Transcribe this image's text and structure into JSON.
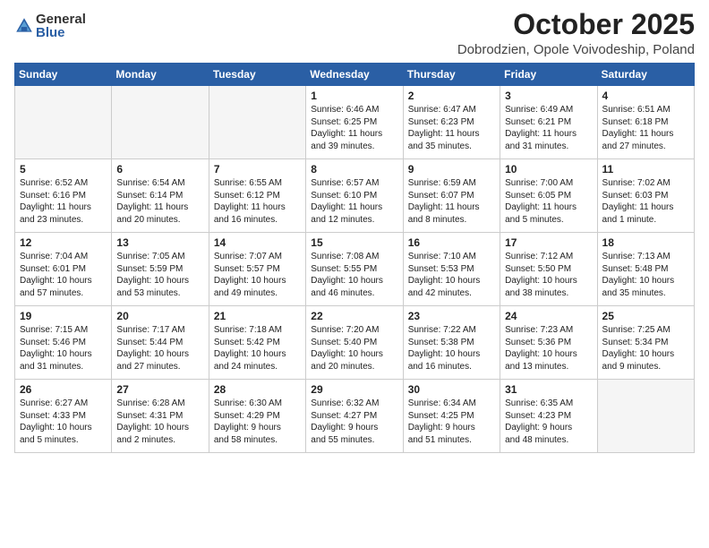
{
  "logo": {
    "general": "General",
    "blue": "Blue"
  },
  "header": {
    "month": "October 2025",
    "location": "Dobrodzien, Opole Voivodeship, Poland"
  },
  "days_of_week": [
    "Sunday",
    "Monday",
    "Tuesday",
    "Wednesday",
    "Thursday",
    "Friday",
    "Saturday"
  ],
  "weeks": [
    [
      {
        "num": "",
        "detail": "",
        "empty": true
      },
      {
        "num": "",
        "detail": "",
        "empty": true
      },
      {
        "num": "",
        "detail": "",
        "empty": true
      },
      {
        "num": "1",
        "detail": "Sunrise: 6:46 AM\nSunset: 6:25 PM\nDaylight: 11 hours\nand 39 minutes.",
        "empty": false
      },
      {
        "num": "2",
        "detail": "Sunrise: 6:47 AM\nSunset: 6:23 PM\nDaylight: 11 hours\nand 35 minutes.",
        "empty": false
      },
      {
        "num": "3",
        "detail": "Sunrise: 6:49 AM\nSunset: 6:21 PM\nDaylight: 11 hours\nand 31 minutes.",
        "empty": false
      },
      {
        "num": "4",
        "detail": "Sunrise: 6:51 AM\nSunset: 6:18 PM\nDaylight: 11 hours\nand 27 minutes.",
        "empty": false
      }
    ],
    [
      {
        "num": "5",
        "detail": "Sunrise: 6:52 AM\nSunset: 6:16 PM\nDaylight: 11 hours\nand 23 minutes.",
        "empty": false
      },
      {
        "num": "6",
        "detail": "Sunrise: 6:54 AM\nSunset: 6:14 PM\nDaylight: 11 hours\nand 20 minutes.",
        "empty": false
      },
      {
        "num": "7",
        "detail": "Sunrise: 6:55 AM\nSunset: 6:12 PM\nDaylight: 11 hours\nand 16 minutes.",
        "empty": false
      },
      {
        "num": "8",
        "detail": "Sunrise: 6:57 AM\nSunset: 6:10 PM\nDaylight: 11 hours\nand 12 minutes.",
        "empty": false
      },
      {
        "num": "9",
        "detail": "Sunrise: 6:59 AM\nSunset: 6:07 PM\nDaylight: 11 hours\nand 8 minutes.",
        "empty": false
      },
      {
        "num": "10",
        "detail": "Sunrise: 7:00 AM\nSunset: 6:05 PM\nDaylight: 11 hours\nand 5 minutes.",
        "empty": false
      },
      {
        "num": "11",
        "detail": "Sunrise: 7:02 AM\nSunset: 6:03 PM\nDaylight: 11 hours\nand 1 minute.",
        "empty": false
      }
    ],
    [
      {
        "num": "12",
        "detail": "Sunrise: 7:04 AM\nSunset: 6:01 PM\nDaylight: 10 hours\nand 57 minutes.",
        "empty": false
      },
      {
        "num": "13",
        "detail": "Sunrise: 7:05 AM\nSunset: 5:59 PM\nDaylight: 10 hours\nand 53 minutes.",
        "empty": false
      },
      {
        "num": "14",
        "detail": "Sunrise: 7:07 AM\nSunset: 5:57 PM\nDaylight: 10 hours\nand 49 minutes.",
        "empty": false
      },
      {
        "num": "15",
        "detail": "Sunrise: 7:08 AM\nSunset: 5:55 PM\nDaylight: 10 hours\nand 46 minutes.",
        "empty": false
      },
      {
        "num": "16",
        "detail": "Sunrise: 7:10 AM\nSunset: 5:53 PM\nDaylight: 10 hours\nand 42 minutes.",
        "empty": false
      },
      {
        "num": "17",
        "detail": "Sunrise: 7:12 AM\nSunset: 5:50 PM\nDaylight: 10 hours\nand 38 minutes.",
        "empty": false
      },
      {
        "num": "18",
        "detail": "Sunrise: 7:13 AM\nSunset: 5:48 PM\nDaylight: 10 hours\nand 35 minutes.",
        "empty": false
      }
    ],
    [
      {
        "num": "19",
        "detail": "Sunrise: 7:15 AM\nSunset: 5:46 PM\nDaylight: 10 hours\nand 31 minutes.",
        "empty": false
      },
      {
        "num": "20",
        "detail": "Sunrise: 7:17 AM\nSunset: 5:44 PM\nDaylight: 10 hours\nand 27 minutes.",
        "empty": false
      },
      {
        "num": "21",
        "detail": "Sunrise: 7:18 AM\nSunset: 5:42 PM\nDaylight: 10 hours\nand 24 minutes.",
        "empty": false
      },
      {
        "num": "22",
        "detail": "Sunrise: 7:20 AM\nSunset: 5:40 PM\nDaylight: 10 hours\nand 20 minutes.",
        "empty": false
      },
      {
        "num": "23",
        "detail": "Sunrise: 7:22 AM\nSunset: 5:38 PM\nDaylight: 10 hours\nand 16 minutes.",
        "empty": false
      },
      {
        "num": "24",
        "detail": "Sunrise: 7:23 AM\nSunset: 5:36 PM\nDaylight: 10 hours\nand 13 minutes.",
        "empty": false
      },
      {
        "num": "25",
        "detail": "Sunrise: 7:25 AM\nSunset: 5:34 PM\nDaylight: 10 hours\nand 9 minutes.",
        "empty": false
      }
    ],
    [
      {
        "num": "26",
        "detail": "Sunrise: 6:27 AM\nSunset: 4:33 PM\nDaylight: 10 hours\nand 5 minutes.",
        "empty": false
      },
      {
        "num": "27",
        "detail": "Sunrise: 6:28 AM\nSunset: 4:31 PM\nDaylight: 10 hours\nand 2 minutes.",
        "empty": false
      },
      {
        "num": "28",
        "detail": "Sunrise: 6:30 AM\nSunset: 4:29 PM\nDaylight: 9 hours\nand 58 minutes.",
        "empty": false
      },
      {
        "num": "29",
        "detail": "Sunrise: 6:32 AM\nSunset: 4:27 PM\nDaylight: 9 hours\nand 55 minutes.",
        "empty": false
      },
      {
        "num": "30",
        "detail": "Sunrise: 6:34 AM\nSunset: 4:25 PM\nDaylight: 9 hours\nand 51 minutes.",
        "empty": false
      },
      {
        "num": "31",
        "detail": "Sunrise: 6:35 AM\nSunset: 4:23 PM\nDaylight: 9 hours\nand 48 minutes.",
        "empty": false
      },
      {
        "num": "",
        "detail": "",
        "empty": true
      }
    ]
  ]
}
